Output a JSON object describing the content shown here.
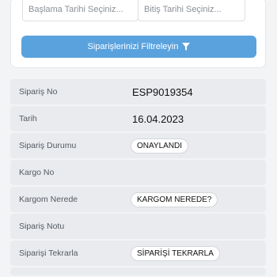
{
  "filter": {
    "start_placeholder": "Başlama Tarihi Seçiniz...",
    "end_placeholder": "Bitiş Tarihi Seçiniz...",
    "button_label": "Siparişlerinizi Filtreleyin",
    "button_icon": "filter-icon"
  },
  "order": {
    "order_no_label": "Sipariş No",
    "order_no_value": "ESP9019354",
    "date_label": "Tarih",
    "date_value": "16.04.2023",
    "status_label": "Sipariş Durumu",
    "status_value": "ONAYLANDI",
    "cargo_no_label": "Kargo No",
    "cargo_no_value": "",
    "cargo_where_label": "Kargom Nerede",
    "cargo_where_button": "KARGOM NEREDE?",
    "order_note_label": "Sipariş Notu",
    "order_note_value": "",
    "reorder_label": "Siparişi Tekrarla",
    "reorder_button": "SİPARİŞİ TEKRARLA"
  },
  "colors": {
    "primary": "#5aa2dd",
    "row_bg": "#e9ebee",
    "page_bg": "#f3f4f6"
  }
}
